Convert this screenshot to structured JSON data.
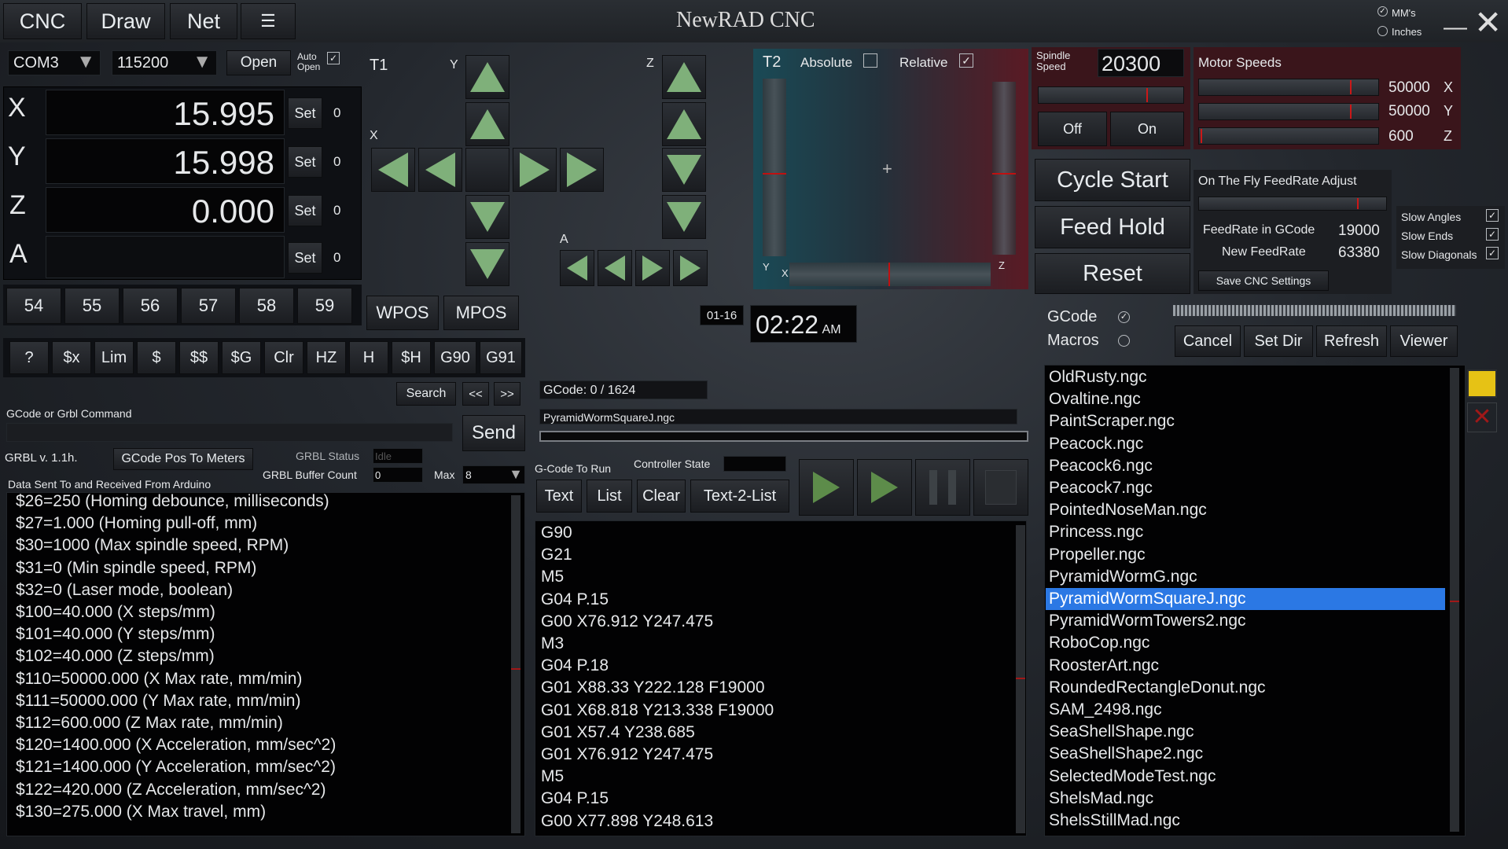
{
  "title": "NewRAD CNC",
  "menu": {
    "cnc": "CNC",
    "draw": "Draw",
    "net": "Net"
  },
  "units": {
    "mm": "MM's",
    "inches": "Inches"
  },
  "conn": {
    "port": "COM3",
    "baud": "115200",
    "open": "Open",
    "auto_open": "Auto Open",
    "auto_checked": "✓"
  },
  "axes": [
    {
      "name": "X",
      "value": "15.995",
      "set": "Set",
      "offset": "0"
    },
    {
      "name": "Y",
      "value": "15.998",
      "set": "Set",
      "offset": "0"
    },
    {
      "name": "Z",
      "value": "0.000",
      "set": "Set",
      "offset": "0"
    },
    {
      "name": "A",
      "value": "",
      "set": "Set",
      "offset": "0"
    }
  ],
  "wcs": [
    "54",
    "55",
    "56",
    "57",
    "58",
    "59"
  ],
  "pos_mode": {
    "wpos": "WPOS",
    "mpos": "MPOS"
  },
  "jog": {
    "t1": "T1",
    "y": "Y",
    "x": "X",
    "z": "Z",
    "a": "A"
  },
  "t2": {
    "label": "T2",
    "absolute": "Absolute",
    "relative": "Relative",
    "relative_checked": "✓",
    "y": "Y",
    "x": "X",
    "z": "Z"
  },
  "quick_cmds": [
    "?",
    "$x",
    "Lim",
    "$",
    "$$",
    "$G",
    "Clr",
    "HZ",
    "H",
    "$H",
    "G90",
    "G91"
  ],
  "command": {
    "label": "GCode or Grbl Command",
    "search": "Search",
    "prev": "<<",
    "next": ">>",
    "send": "Send"
  },
  "grbl": {
    "version": "GRBL v. 1.1h.",
    "pos_to_meters": "GCode Pos To Meters",
    "status_label": "GRBL Status",
    "status_value": "Idle",
    "buffer_label": "GRBL Buffer Count",
    "buffer_value": "0",
    "max_label": "Max",
    "max_value": "8",
    "data_label": "Data Sent To and Received From Arduino"
  },
  "log": [
    "$26=250 (Homing debounce, milliseconds)",
    "$27=1.000 (Homing pull-off, mm)",
    "$30=1000 (Max spindle speed, RPM)",
    "$31=0 (Min spindle speed, RPM)",
    "$32=0 (Laser mode, boolean)",
    "$100=40.000 (X steps/mm)",
    "$101=40.000 (Y steps/mm)",
    "$102=40.000 (Z steps/mm)",
    "$110=50000.000 (X Max rate, mm/min)",
    "$111=50000.000 (Y Max rate, mm/min)",
    "$112=600.000 (Z Max rate, mm/min)",
    "$120=1400.000 (X Acceleration, mm/sec^2)",
    "$121=1400.000 (Y Acceleration, mm/sec^2)",
    "$122=420.000 (Z Acceleration, mm/sec^2)",
    "$130=275.000 (X Max travel, mm)"
  ],
  "clock": {
    "date": "01-16",
    "time": "02:22",
    "ampm": "AM"
  },
  "gcode_run": {
    "progress": "GCode: 0 / 1624",
    "file": "PyramidWormSquareJ.ngc",
    "label": "G-Code To Run",
    "state_label": "Controller State",
    "text": "Text",
    "list": "List",
    "clear": "Clear",
    "text2list": "Text-2-List"
  },
  "gcode_lines": [
    "G90",
    "G21",
    "M5",
    "G04 P.15",
    "G00 X76.912 Y247.475",
    "M3",
    "G04 P.18",
    "G01 X88.33 Y222.128 F19000",
    "G01 X68.818 Y213.338 F19000",
    "G01 X57.4 Y238.685",
    "G01 X76.912 Y247.475",
    "M5",
    "G04 P.15",
    "G00 X77.898 Y248.613"
  ],
  "spindle": {
    "label": "Spindle Speed",
    "value": "20300",
    "off": "Off",
    "on": "On",
    "slider_level": 0.75
  },
  "motor": {
    "label": "Motor Speeds",
    "items": [
      {
        "value": "50000",
        "axis": "X",
        "level": 0.85
      },
      {
        "value": "50000",
        "axis": "Y",
        "level": 0.85
      },
      {
        "value": "600",
        "axis": "Z",
        "level": 0.01
      }
    ]
  },
  "controls": {
    "cycle_start": "Cycle Start",
    "feed_hold": "Feed Hold",
    "reset": "Reset"
  },
  "feed": {
    "label": "On The Fly FeedRate Adjust",
    "level": 0.85,
    "in_gcode_label": "FeedRate in GCode",
    "in_gcode": "19000",
    "new_label": "New FeedRate",
    "new_value": "63380",
    "save": "Save CNC Settings"
  },
  "slow": [
    {
      "label": "Slow Angles",
      "checked": "✓"
    },
    {
      "label": "Slow Ends",
      "checked": "✓"
    },
    {
      "label": "Slow Diagonals",
      "checked": "✓"
    }
  ],
  "files": {
    "gcode": "GCode",
    "macros": "Macros",
    "cancel": "Cancel",
    "set_dir": "Set Dir",
    "refresh": "Refresh",
    "viewer": "Viewer",
    "selected": "PyramidWormSquareJ.ngc",
    "items": [
      "OldRusty.ngc",
      "Ovaltine.ngc",
      "PaintScraper.ngc",
      "Peacock.ngc",
      "Peacock6.ngc",
      "Peacock7.ngc",
      "PointedNoseMan.ngc",
      "Princess.ngc",
      "Propeller.ngc",
      "PyramidWormG.ngc",
      "PyramidWormSquareJ.ngc",
      "PyramidWormTowers2.ngc",
      "RoboCop.ngc",
      "RoosterArt.ngc",
      "RoundedRectangleDonut.ngc",
      "SAM_2498.ngc",
      "SeaShellShape.ngc",
      "SeaShellShape2.ngc",
      "SelectedModeTest.ngc",
      "ShelsMad.ngc",
      "ShelsStillMad.ngc"
    ]
  },
  "colors": {
    "accent_red": "#8c1a28",
    "play_green": "#5d8c4a",
    "select_blue": "#2b78e4",
    "folder_yellow": "#e6c215"
  }
}
